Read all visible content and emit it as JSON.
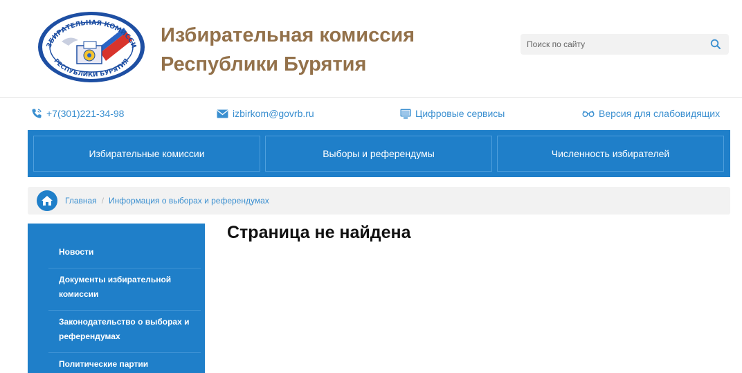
{
  "header": {
    "logo_top_text": "ИЗБИРАТЕЛЬНАЯ КОМИССИЯ",
    "logo_bottom_text": "РЕСПУБЛИКИ БУРЯТИЯ",
    "title_line1": "Избирательная комиссия",
    "title_line2": "Республики Бурятия"
  },
  "search": {
    "placeholder": "Поиск по сайту",
    "icon": "search-icon"
  },
  "contacts": {
    "phone": "+7(301)221-34-98",
    "email": "izbirkom@govrb.ru",
    "digital": "Цифровые сервисы",
    "accessibility": "Версия для слабовидящих"
  },
  "nav": {
    "items": [
      "Избирательные комиссии",
      "Выборы и референдумы",
      "Численность избирателей"
    ]
  },
  "breadcrumb": {
    "home": "Главная",
    "current": "Информация о выборах и референдумах"
  },
  "sidebar": {
    "items": [
      "Новости",
      "Документы избирательной комиссии",
      "Законодательство о выборах и референдумах",
      "Политические партии"
    ]
  },
  "content": {
    "heading": "Страница не найдена"
  },
  "colors": {
    "brand_blue": "#1f7fc9",
    "link_blue": "#3a8fd0",
    "title_brown": "#93714a"
  }
}
